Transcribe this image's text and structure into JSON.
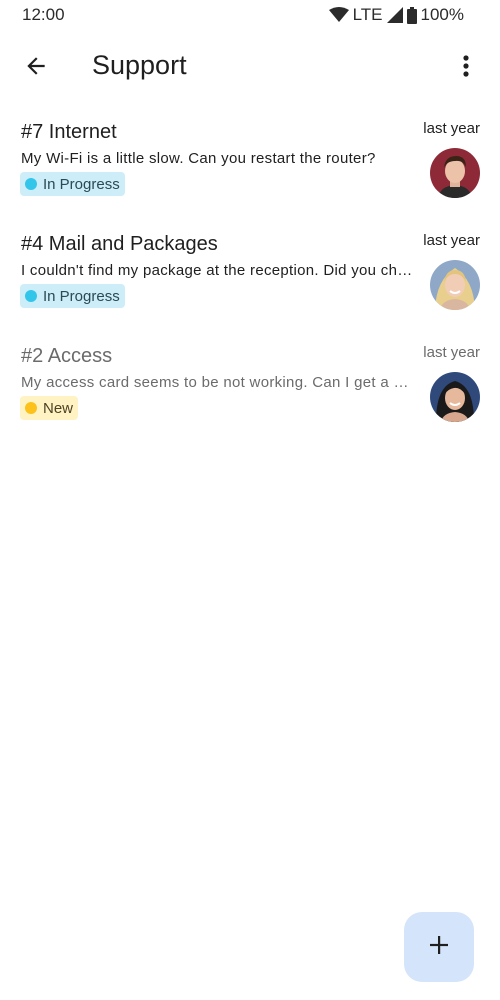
{
  "status_bar": {
    "time": "12:00",
    "network": "LTE",
    "battery": "100%"
  },
  "app_bar": {
    "title": "Support",
    "back_icon": "arrow-back-icon",
    "menu_icon": "more-vert-icon"
  },
  "tickets": [
    {
      "title": "#7 Internet",
      "time": "last year",
      "message": "My Wi-Fi is a little slow. Can you restart the router?",
      "status": "In Progress",
      "read": false
    },
    {
      "title": "#4 Mail and Packages",
      "time": "last year",
      "message": "I couldn't find my package at the reception. Did you check if it was delivered?",
      "status": "In Progress",
      "read": false
    },
    {
      "title": "#2 Access",
      "time": "last year",
      "message": "My access card seems to be not working. Can I get a new one?",
      "status": "New",
      "read": true
    }
  ],
  "fab": {
    "icon": "add-icon"
  },
  "colors": {
    "in_progress_chip_bg": "#cdeef8",
    "in_progress_dot": "#33c6ea",
    "new_chip_bg": "#fff3c4",
    "new_dot": "#fcc21b",
    "fab_bg": "#d4e4fb"
  }
}
